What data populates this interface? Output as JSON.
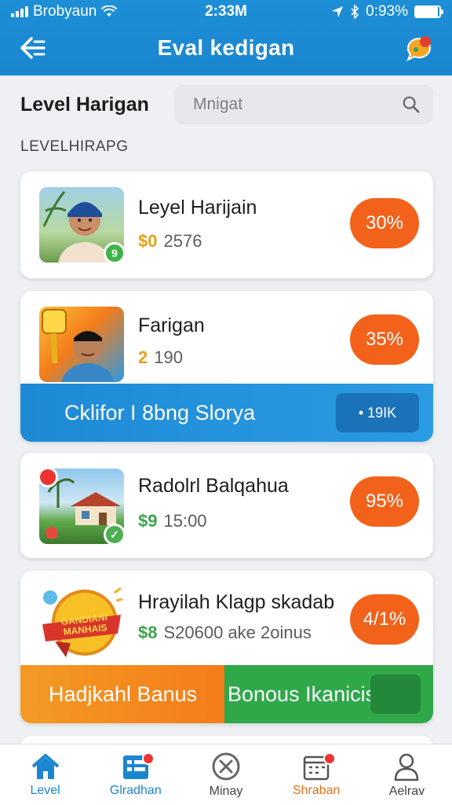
{
  "status_bar": {
    "carrier": "Brobyaun",
    "time": "2:33M",
    "battery": "0:93%",
    "battery_level": 0.93
  },
  "nav": {
    "title": "Eval kedigan",
    "back_icon": "back-arrow-icon",
    "chat_icon": "chat-bubble-icon"
  },
  "header": {
    "title": "Level Harigan",
    "search_placeholder": "Mnigat"
  },
  "section_label": "LEVELHIRAPG",
  "items": [
    {
      "title": "Leyel Harijain",
      "coin": "$0",
      "value": "2576",
      "percent": "30%",
      "thumb_badge": "9"
    },
    {
      "title": "Farigan",
      "coin": "2",
      "value": "190",
      "percent": "35%",
      "banner_text": "Cklifor I 8bng Slorya",
      "banner_button": "• 19IK"
    },
    {
      "title": "Radolrl Balqahua",
      "coin": "$9",
      "value": "15:00",
      "percent": "95%"
    },
    {
      "title": "Hrayilah Klagp skadab",
      "coin": "$8",
      "value": "S20600 ake 2oinus",
      "percent": "4/1%",
      "banner_left": "Hadjkahl Banus",
      "banner_right": "Bonous Ikanicis",
      "sticker_text": "GANDIANI MANHAIS"
    }
  ],
  "bottom_nav": [
    {
      "label": "Level",
      "icon": "home-icon",
      "active": true,
      "badge": false
    },
    {
      "label": "Glradhan",
      "icon": "list-icon",
      "active": false,
      "badge": true
    },
    {
      "label": "Minay",
      "icon": "tools-icon",
      "active": false,
      "badge": false
    },
    {
      "label": "Shraban",
      "icon": "calendar-icon",
      "active": false,
      "badge": true
    },
    {
      "label": "Aelrav",
      "icon": "profile-icon",
      "active": false,
      "badge": false
    }
  ],
  "colors": {
    "primary": "#1a86cf",
    "accent_orange": "#f2621a",
    "green": "#2fa84a"
  }
}
